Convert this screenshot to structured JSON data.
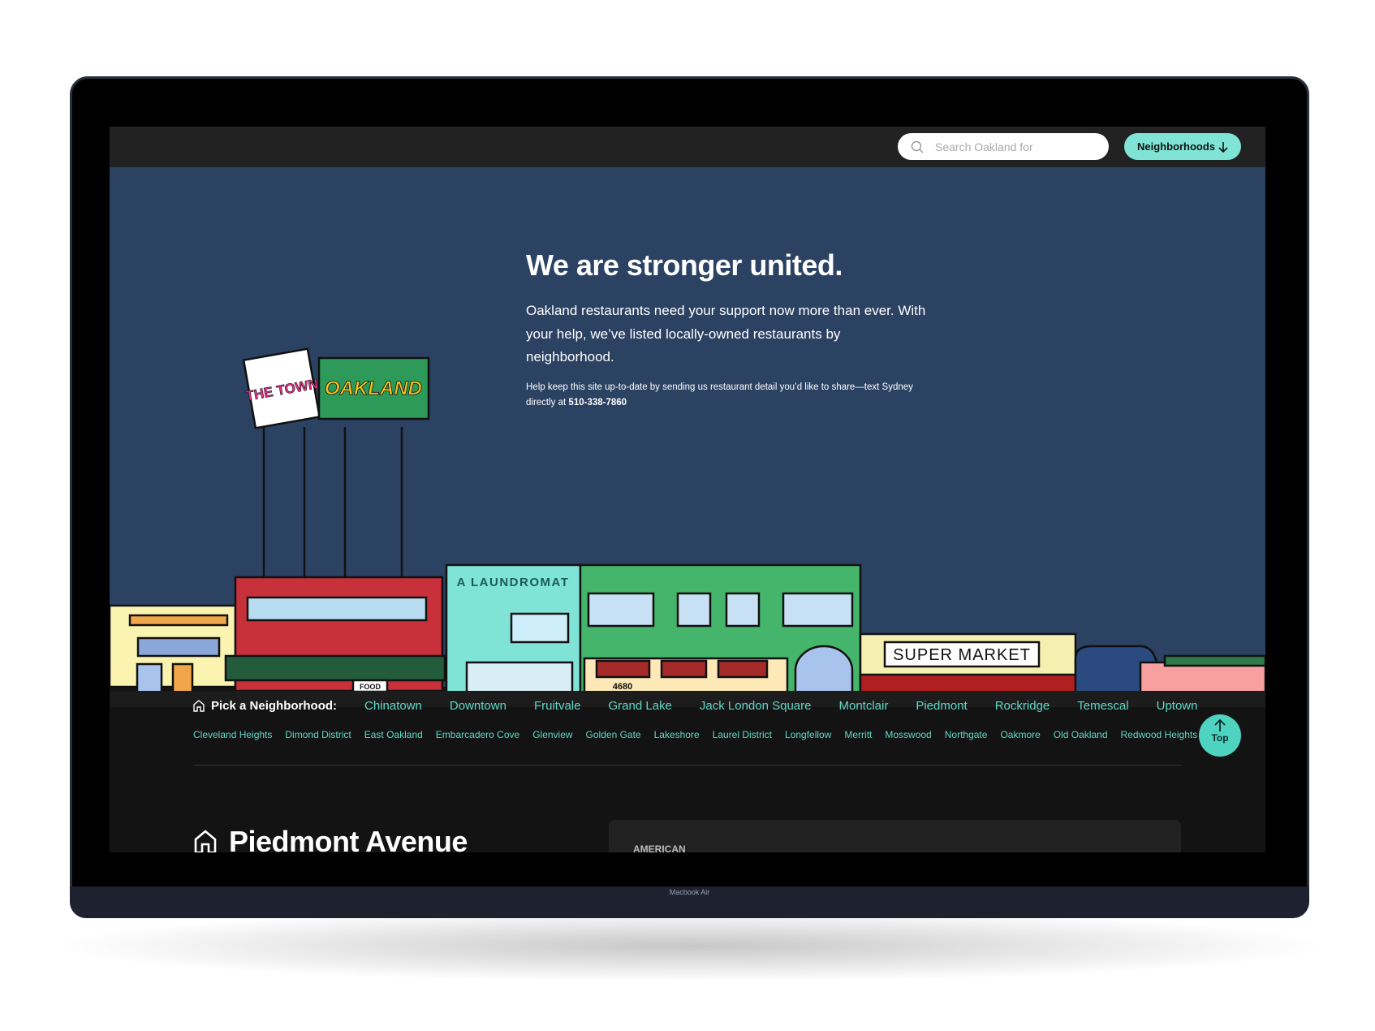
{
  "device_label": "Macbook Air",
  "topbar": {
    "search_placeholder": "Search Oakland for",
    "neighborhoods_button": "Neighborhoods"
  },
  "hero": {
    "title": "We are stronger united.",
    "body": "Oakland restaurants need your support now more than ever. With your help, we’ve listed locally-owned restaurants by neighborhood.",
    "note": "Help keep this site up-to-date by sending us restaurant detail you’d like to share—text Sydney directly at",
    "phone": "510-338-7860",
    "illustration_signs": [
      "THE TOWN",
      "OAKLAND",
      "A LAUNDROMAT",
      "SUPER MARKET",
      "4680",
      "FOOD"
    ]
  },
  "nav": {
    "label": "Pick a Neighborhood:",
    "primary": [
      "Chinatown",
      "Downtown",
      "Fruitvale",
      "Grand Lake",
      "Jack London Square",
      "Montclair",
      "Piedmont",
      "Rockridge",
      "Temescal",
      "Uptown"
    ],
    "secondary": [
      "Cleveland Heights",
      "Dimond District",
      "East Oakland",
      "Embarcadero Cove",
      "Glenview",
      "Golden Gate",
      "Lakeshore",
      "Laurel District",
      "Longfellow",
      "Merritt",
      "Mosswood",
      "Northgate",
      "Oakmore",
      "Old Oakland",
      "Redwood Heights"
    ]
  },
  "top_button": "Top",
  "section": {
    "title": "Piedmont Avenue",
    "card_category": "AMERICAN"
  },
  "colors": {
    "accent": "#7fe3d6",
    "hero_bg": "#2b4263",
    "link": "#5fd9c6"
  }
}
